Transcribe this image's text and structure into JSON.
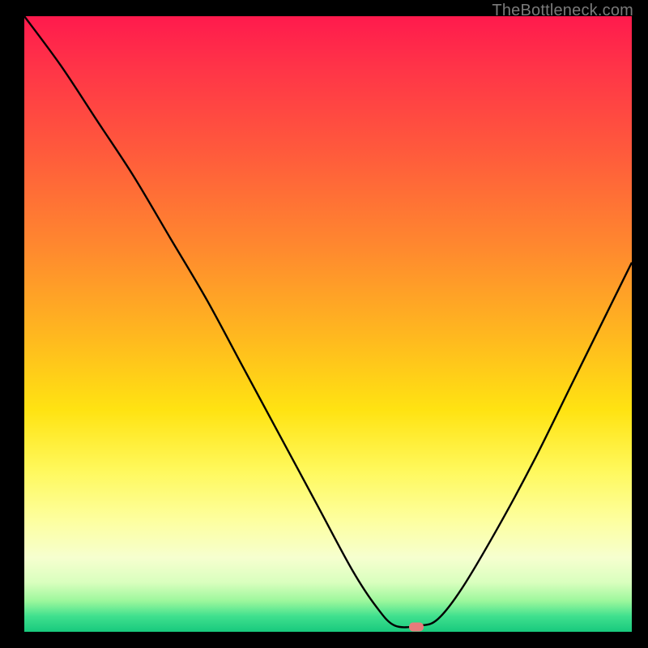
{
  "watermark": "TheBottleneck.com",
  "marker": {
    "x_frac": 0.645,
    "y_frac": 0.992
  },
  "chart_data": {
    "type": "line",
    "title": "",
    "xlabel": "",
    "ylabel": "",
    "xlim": [
      0,
      1
    ],
    "ylim": [
      0,
      1
    ],
    "series": [
      {
        "name": "bottleneck-curve",
        "x": [
          0.0,
          0.06,
          0.12,
          0.18,
          0.24,
          0.3,
          0.36,
          0.42,
          0.48,
          0.54,
          0.58,
          0.61,
          0.65,
          0.68,
          0.72,
          0.78,
          0.84,
          0.9,
          0.96,
          1.0
        ],
        "values": [
          1.0,
          0.92,
          0.83,
          0.74,
          0.64,
          0.54,
          0.43,
          0.32,
          0.21,
          0.1,
          0.04,
          0.01,
          0.01,
          0.02,
          0.07,
          0.17,
          0.28,
          0.4,
          0.52,
          0.6
        ]
      }
    ],
    "annotations": [
      {
        "text": "TheBottleneck.com",
        "role": "watermark",
        "position": "top-right"
      }
    ],
    "background_gradient": {
      "top": "#ff1a4d",
      "mid": "#ffd21f",
      "bottom": "#18c97d"
    }
  }
}
